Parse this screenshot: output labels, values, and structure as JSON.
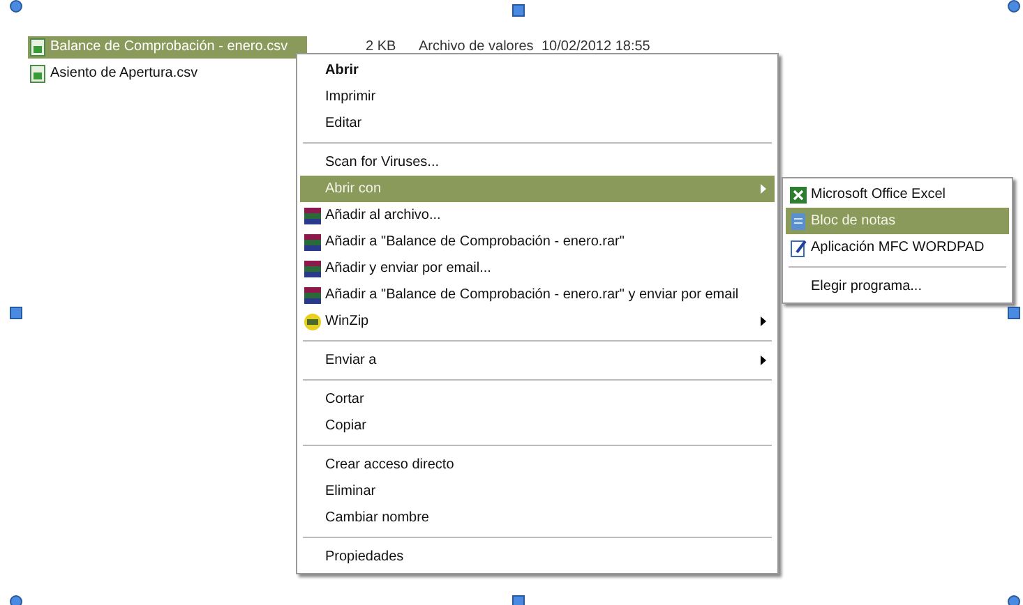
{
  "files": [
    {
      "name": "Balance de Comprobación - enero.csv",
      "size": "2 KB",
      "type": "Archivo de valores",
      "modified": "10/02/2012 18:55",
      "selected": true
    },
    {
      "name": "Asiento de Apertura.csv",
      "selected": false
    }
  ],
  "context_menu": {
    "items": [
      {
        "kind": "item",
        "label": "Abrir",
        "default": true,
        "selected": false
      },
      {
        "kind": "item",
        "label": "Imprimir",
        "selected": false
      },
      {
        "kind": "item",
        "label": "Editar",
        "selected": false
      },
      {
        "kind": "separator"
      },
      {
        "kind": "item",
        "label": "Scan for Viruses...",
        "selected": false
      },
      {
        "kind": "item",
        "label": "Abrir con",
        "submenu": true,
        "selected": true
      },
      {
        "kind": "archive",
        "label": "Añadir al archivo...",
        "selected": false
      },
      {
        "kind": "archive",
        "label": "Añadir a \"Balance de Comprobación - enero.rar\"",
        "selected": false
      },
      {
        "kind": "archive",
        "label": "Añadir y enviar por email...",
        "selected": false
      },
      {
        "kind": "archive",
        "label": "Añadir a \"Balance de Comprobación - enero.rar\" y enviar por email",
        "selected": false
      },
      {
        "kind": "winzip",
        "label": "WinZip",
        "submenu": true,
        "selected": false
      },
      {
        "kind": "separator"
      },
      {
        "kind": "item",
        "label": "Enviar a",
        "submenu": true,
        "selected": false
      },
      {
        "kind": "separator"
      },
      {
        "kind": "item",
        "label": "Cortar",
        "selected": false
      },
      {
        "kind": "item",
        "label": "Copiar",
        "selected": false
      },
      {
        "kind": "separator"
      },
      {
        "kind": "item",
        "label": "Crear acceso directo",
        "selected": false
      },
      {
        "kind": "item",
        "label": "Eliminar",
        "selected": false
      },
      {
        "kind": "item",
        "label": "Cambiar nombre",
        "selected": false
      },
      {
        "kind": "separator"
      },
      {
        "kind": "item",
        "label": "Propiedades",
        "selected": false
      }
    ]
  },
  "submenu": {
    "items": [
      {
        "kind": "spreadsheet",
        "label": "Microsoft Office Excel",
        "selected": false
      },
      {
        "kind": "notepad",
        "label": "Bloc de notas",
        "selected": true
      },
      {
        "kind": "wordpad",
        "label": "Aplicación MFC WORDPAD",
        "selected": false
      },
      {
        "kind": "separator"
      },
      {
        "kind": "item",
        "label": "Elegir programa...",
        "selected": false
      }
    ]
  }
}
